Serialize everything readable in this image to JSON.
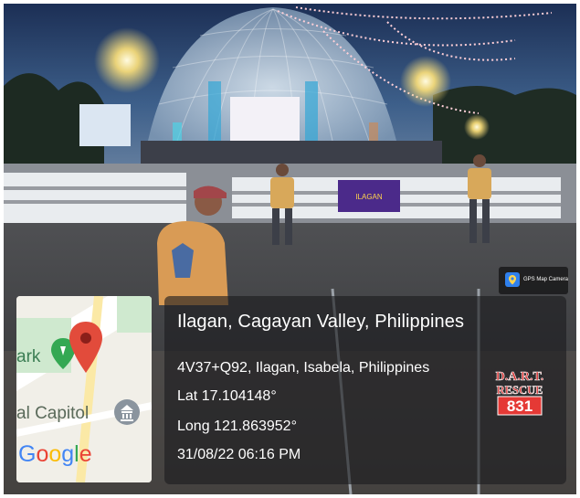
{
  "location": {
    "title": "Ilagan, Cagayan Valley, Philippines",
    "plus_code_address": "4V37+Q92, Ilagan, Isabela, Philippines",
    "latitude": "Lat 17.104148°",
    "longitude": "Long 121.863952°",
    "datetime": "31/08/22 06:16 PM"
  },
  "map": {
    "labels": {
      "park": "ark",
      "capitol": "al Capitol"
    },
    "google": [
      "G",
      "o",
      "o",
      "g",
      "l",
      "e"
    ],
    "google_colors": [
      "#4285F4",
      "#EA4335",
      "#FBBC05",
      "#4285F4",
      "#34A853",
      "#EA4335"
    ],
    "pin_color": "#E24B3B"
  },
  "app_badge": {
    "label": "GPS Map Camera",
    "icon": "camera-pin-icon"
  },
  "logo": {
    "top": "D.A.R.T.",
    "middle": "RESCUE",
    "number": "831"
  },
  "banner": {
    "text": "ILAGAN"
  }
}
